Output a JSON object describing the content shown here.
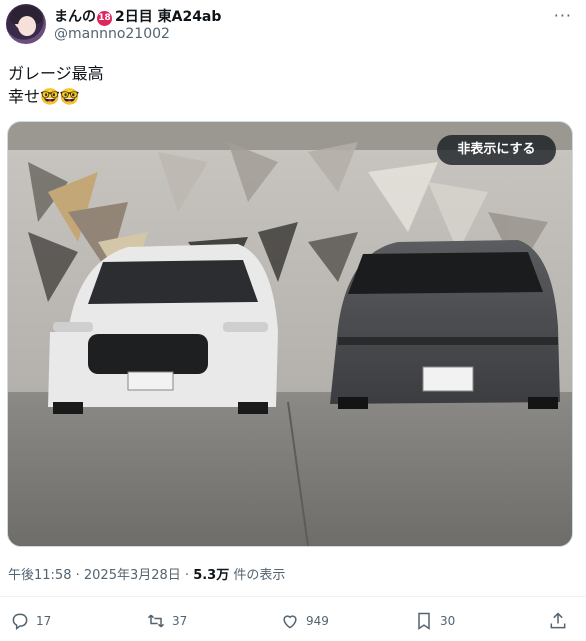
{
  "user": {
    "name": "まんの",
    "badge": "18",
    "suffix": "2日目 東A24ab",
    "handle": "@mannno21002"
  },
  "tweet": {
    "line1": "ガレージ最高",
    "line2": "幸せ🤓🤓"
  },
  "media": {
    "hide_label": "非表示にする"
  },
  "meta": {
    "time": "午後11:58",
    "sep1": " · ",
    "date": "2025年3月28日",
    "sep2": " · ",
    "views": "5.3万",
    "views_suffix": " 件の表示"
  },
  "actions": {
    "reply_count": "17",
    "retweet_count": "37",
    "like_count": "949",
    "bookmark_count": "30"
  },
  "icons": [
    "more-icon",
    "reply-icon",
    "retweet-icon",
    "like-icon",
    "bookmark-icon",
    "share-icon"
  ]
}
